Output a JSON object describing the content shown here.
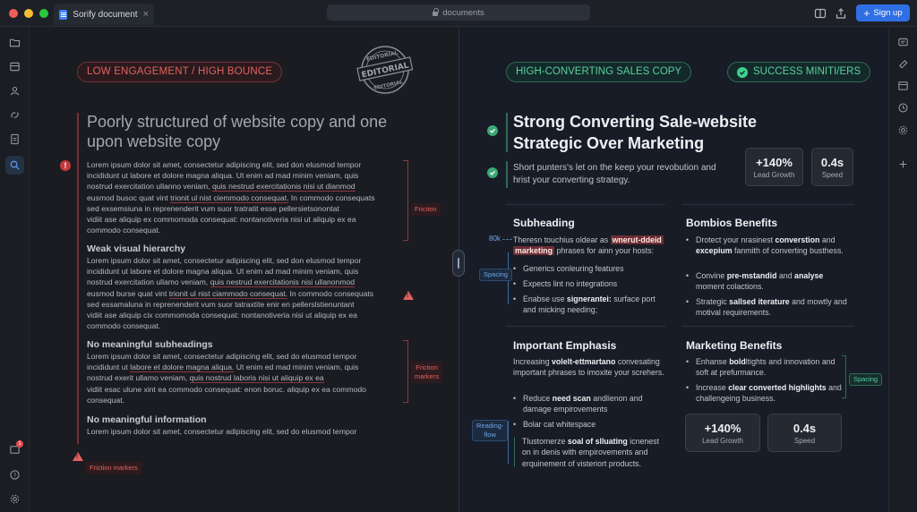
{
  "window": {
    "tab_title": "Sorify document",
    "tab_close": "×",
    "address": "documents",
    "signup_label": "Sign up",
    "colors": {
      "close": "#ef5f57",
      "minimize": "#f5bd2f",
      "maximize": "#2bc840",
      "accent": "#2f6fe4"
    }
  },
  "left": {
    "badge": "LOW ENGAGEMENT / HIGH BOUNCE",
    "stamp": {
      "top": "EDITORIAL",
      "middle": "EDITORIAL",
      "bottom": "EDITORIAL"
    },
    "title": "Poorly structured of website copy and one upon website copy",
    "warn_mark": "!",
    "para1": [
      "Lorem ipsum dolor sit amet, consectetur adipiscing elit, sed don elusmod tempor",
      "incididunt ut labore et dolore magna aliqua. Ut enim ad mad minim veniam, quis",
      "nostrud exercitation ullanno veniam, ",
      "quis nestrud exercitationis nisi ut dianmod",
      "eusmod busoc quat vint ",
      "trionit ul nist ciemmodo consequat.",
      " In commodo consequats",
      "sed exsemsiuna in reprenenderit vum suor tratratit esse pellersietsonontat",
      "vidiit ase aliquip ex commomoda consequat: nontanotiveria nisi ut aliquip ex ea",
      "commodo consequat."
    ],
    "sub1": "Weak visual hierarchy",
    "para2": [
      "Lorem ipsum dolor sit amet, consectetur adipiscing elit, sed don elusmod tempor",
      "incididunt ut labore et dolore magna aliqua. Ut enim ad mad minim veniam, quis",
      "nostrud exercitation ullamo veniam, ",
      "quis nestrud exercitationis nisi ullanonmod",
      "eusmod burse quat vint ",
      "trionit ul nist ciammodo consequat.",
      " In commodo consequats",
      "sed essamaluna in reprenenderit vum suor tatraxtite enir en pellerslstienuntant",
      "vidiit ase aliquip cix commomoda consequat: nontanotiveria nisi ut aliquip ex ea",
      "commodo consequat."
    ],
    "sub2": "No meaningful subheadings",
    "para3": [
      "Lorem ipsum dolor sit amet, consectetur adipiscing elit, sed do elusmod tempor",
      "incididunt ut ",
      "labore et dolore magna aliqua.",
      " Ut enim ed mad minim veniam, quis",
      "nostrud exerit ullamo veniam, ",
      "quis nostrud laboris nisi ut aliquip ex ea",
      "vidiit esac ulune xint ea commodo consequat: enon boruc. aliquip ex ea commodo",
      "consequat."
    ],
    "sub3": "No meaningful information",
    "para4": "Lorem ipsum dolor sit amet, consectetur adipiscing elit, sed do elusmod tempor",
    "tag_friction": "Friction",
    "tag_friction_markers_1": "Friction",
    "tag_friction_markers_2": "markers",
    "tag_bottom": "Friction markers"
  },
  "right": {
    "badge_left": "HIGH-CONVERTING SALES COPY",
    "badge_right": "SUCCESS MINITI/ERS",
    "title": "Strong Converting Sale-website Strategic Over Marketing",
    "short_text": "Short punters's let on the keep your revobution and hrist your converting strategy.",
    "stat1": {
      "value": "+140%",
      "label": "Lead Growth"
    },
    "stat2": {
      "value": "0.4s",
      "label": "Speed"
    },
    "subheading": {
      "title": "Subheading",
      "text_pre": "Theresn touchius oldear as ",
      "text_hl1": "wnerut-ddeid",
      "text_hl2": "marketing",
      "text_post": " phrases for ainn your hosts:",
      "bullets": [
        "Generics conleuring features",
        "Expects lint no integrations",
        "Enabse use signerantei: surface port and micking needing;"
      ],
      "bullet3_pre": "Enabse use ",
      "bullet3_bold": "signerantei:",
      "bullet3_post": " surface port and micking needing;"
    },
    "bombios": {
      "title": "Bombios Benefits",
      "b1_pre": "Drotect your nrasinest ",
      "b1_bold": "converstion",
      "b1_mid": " and ",
      "b1_bold2": "excepium",
      "b1_post": " fanmith of converting busthess.",
      "b2_pre": "Convine ",
      "b2_bold": "pre-mstandid",
      "b2_mid": " and ",
      "b2_bold2": "analyse",
      "b2_post": " moment colactions.",
      "b3_pre": "Strategic ",
      "b3_bold": "sallsed iterature",
      "b3_post": " and mowtly and motival requirements."
    },
    "emphasis": {
      "title": "Important Emphasis",
      "text_pre": "Increasing ",
      "text_bold": "volelt-ettmartano",
      "text_post": " convesating important phrases to imoxite your screhers.",
      "b1_pre": "Reduce ",
      "b1_bold": "need scan",
      "b1_post": " andlienon and damage empirovements",
      "b2": "Bolar cat whitespace",
      "closing_pre": "Tlustomerze ",
      "closing_bold": "soal of slluating",
      "closing_post": " icnenest on in denis with empirovements and erquinement of visteriort products."
    },
    "marketing": {
      "title": "Marketing Benefits",
      "b1_pre": "Enhanse ",
      "b1_bold": "bold",
      "b1_post": "ltights and innovation and soft at prefurmance.",
      "b2_pre": "Increase ",
      "b2_bold": "clear converted highlights",
      "b2_post": " and challengeing business."
    },
    "stat3": {
      "value": "+140%",
      "label": "Lead Growth"
    },
    "stat4": {
      "value": "0.4s",
      "label": "Speed"
    },
    "tag_80k": "80k",
    "tag_spacing_left": "Spacing",
    "tag_reading_1": "Reading-",
    "tag_reading_2": "flow",
    "tag_spacing_right": "Spacing"
  },
  "notification_badge": "1"
}
